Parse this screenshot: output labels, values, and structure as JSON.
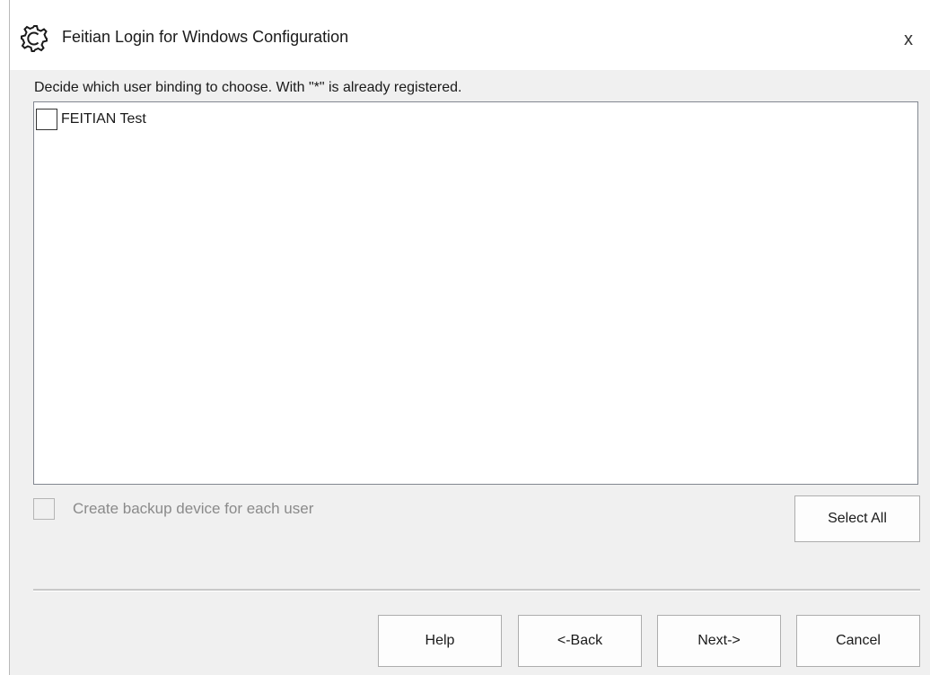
{
  "window": {
    "title": "Feitian Login for Windows Configuration",
    "app_icon": "gear-icon",
    "close_label": "x"
  },
  "instruction": "Decide which user binding to choose. With \"*\" is already registered.",
  "user_list": {
    "items": [
      {
        "label": "FEITIAN Test",
        "checked": false
      }
    ]
  },
  "backup_option": {
    "label": "Create backup device for each user",
    "checked": false,
    "enabled": false
  },
  "buttons": {
    "select_all": "Select All",
    "help": "Help",
    "back": "<-Back",
    "next": "Next->",
    "cancel": "Cancel"
  }
}
